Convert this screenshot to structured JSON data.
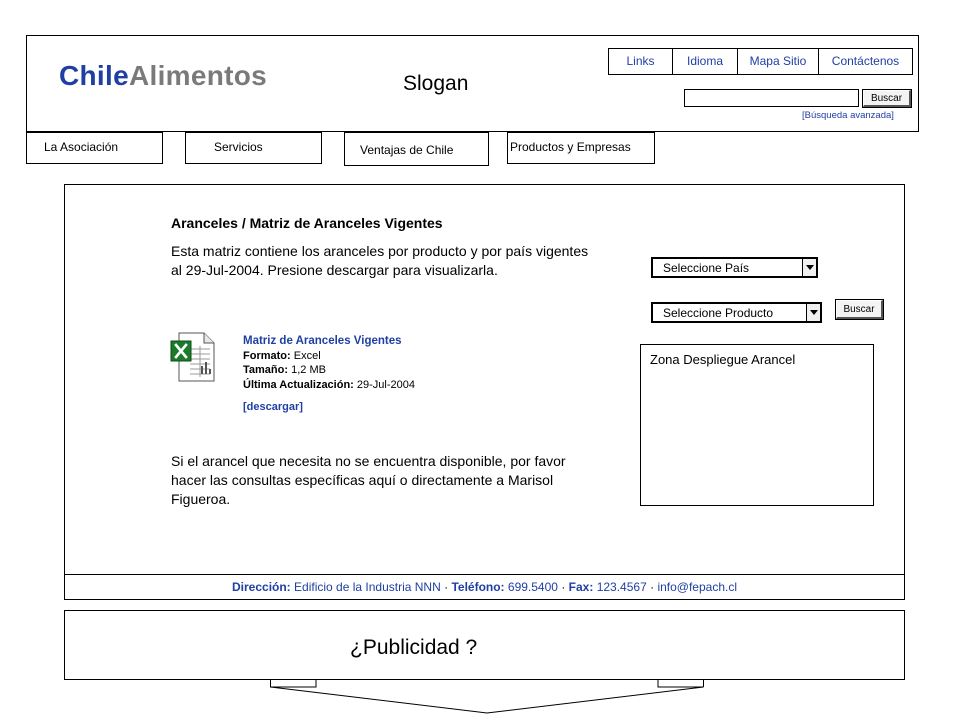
{
  "brand": {
    "name_part1": "Chile",
    "name_part2": "Alimentos",
    "color_primary": "#1f3fa3",
    "color_secondary": "#7a7a7a"
  },
  "header": {
    "slogan": "Slogan"
  },
  "top_links": [
    {
      "label": "Links"
    },
    {
      "label": "Idioma"
    },
    {
      "label": "Mapa Sitio"
    },
    {
      "label": "Contáctenos"
    }
  ],
  "search": {
    "value": "",
    "button_label": "Buscar",
    "advanced_label": "[Búsqueda avanzada]"
  },
  "nav": {
    "tabs": [
      {
        "label": "La Asociación"
      },
      {
        "label": "Servicios"
      },
      {
        "label": "Ventajas de Chile"
      },
      {
        "label": "Productos y Empresas"
      }
    ]
  },
  "main": {
    "title": "Aranceles / Matriz de Aranceles Vigentes",
    "intro": "Esta matriz contiene los aranceles por producto y por país vigentes al 29-Jul-2004. Presione descargar para visualizarla.",
    "file": {
      "icon": "excel-file-icon",
      "name": "Matriz de Aranceles Vigentes",
      "format_label": "Formato:",
      "format_value": "Excel",
      "size_label": "Tamaño:",
      "size_value": "1,2 MB",
      "updated_label": "Última Actualización:",
      "updated_value": "29-Jul-2004",
      "download_label": "[descargar]"
    },
    "note": "Si el arancel que necesita no se encuentra disponible, por favor hacer las consultas específicas aquí o directamente a Marisol Figueroa."
  },
  "filters": {
    "country_select": "Seleccione País",
    "product_select": "Seleccione Producto",
    "button_label": "Buscar",
    "display_zone_label": "Zona Despliegue Arancel"
  },
  "footer": {
    "address_label": "Dirección:",
    "address_value": "Edificio de la Industria NNN",
    "phone_label": "Teléfono:",
    "phone_value": "699.5400",
    "fax_label": "Fax:",
    "fax_value": "123.4567",
    "email": "info@fepach.cl"
  },
  "ad": {
    "label": "¿Publicidad ?"
  }
}
